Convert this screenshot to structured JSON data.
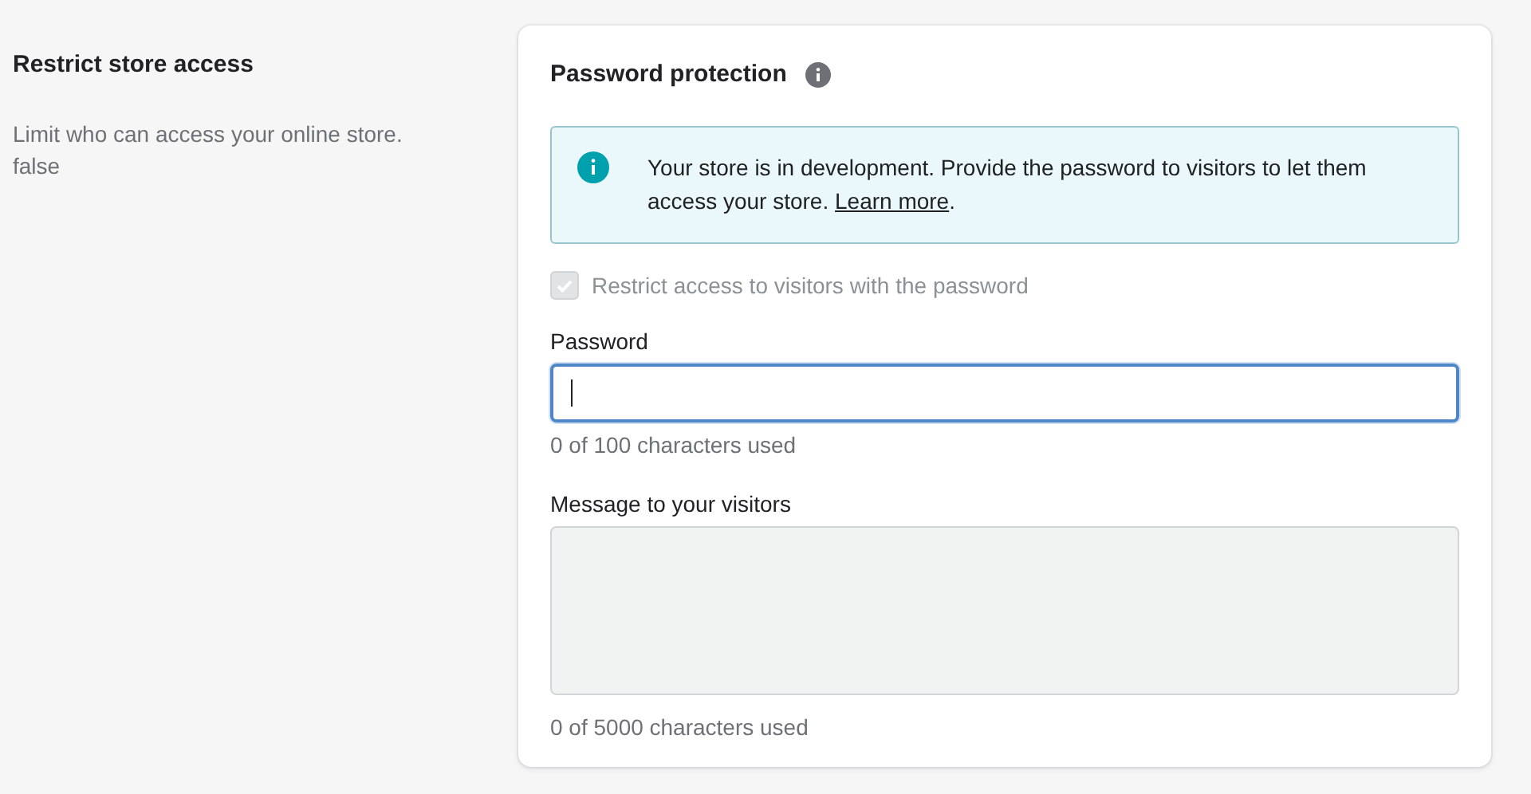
{
  "section": {
    "title": "Restrict store access",
    "description": "Limit who can access your online store.",
    "description_2": "false"
  },
  "card": {
    "title": "Password protection",
    "banner": {
      "text": "Your store is in development. Provide the password to visitors to let them access your store. ",
      "link": "Learn more",
      "text_after": "."
    },
    "checkbox": {
      "label": "Restrict access to visitors with the password",
      "checked": true,
      "disabled": true
    },
    "fields": [
      {
        "kind": "input",
        "label": "Password",
        "focused": true,
        "disabled": false,
        "helper": "0 of 100 characters used"
      },
      {
        "kind": "textarea",
        "label": "Message to your visitors",
        "focused": false,
        "disabled": true,
        "helper": "0 of 5000 characters used"
      }
    ]
  }
}
